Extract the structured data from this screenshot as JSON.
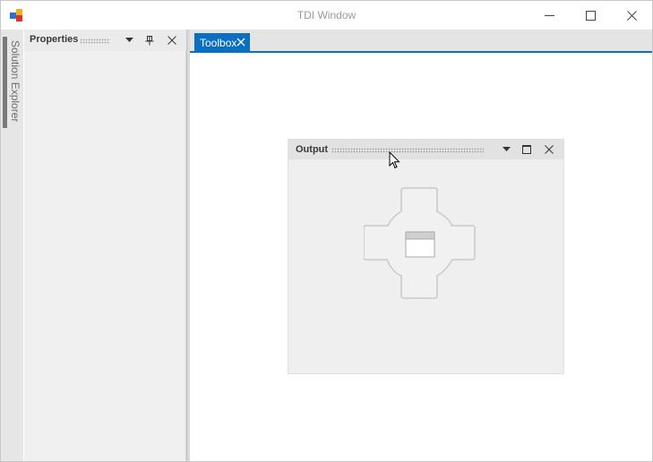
{
  "window": {
    "title": "TDI Window",
    "icon": "app-window-icon",
    "controls": [
      "minimize-icon",
      "maximize-icon",
      "close-icon"
    ]
  },
  "autohide": {
    "tab_label": "Solution Explorer"
  },
  "properties_panel": {
    "title": "Properties",
    "buttons": [
      "dropdown-arrow-icon",
      "pin-icon",
      "close-icon"
    ]
  },
  "document_tabs": [
    {
      "label": "Toolbox",
      "active": true
    }
  ],
  "output_window": {
    "title": "Output",
    "buttons": [
      "dropdown-arrow-icon",
      "maximize-icon",
      "close-icon"
    ]
  },
  "dock_guide": {
    "icon": "dock-guide-icon",
    "center_icon": "dock-fill-icon"
  },
  "colors": {
    "accent": "#0a6fc2",
    "panel_background": "#f0f0f0",
    "header_background": "#ebebeb",
    "title_text": "#9a9a9a"
  }
}
